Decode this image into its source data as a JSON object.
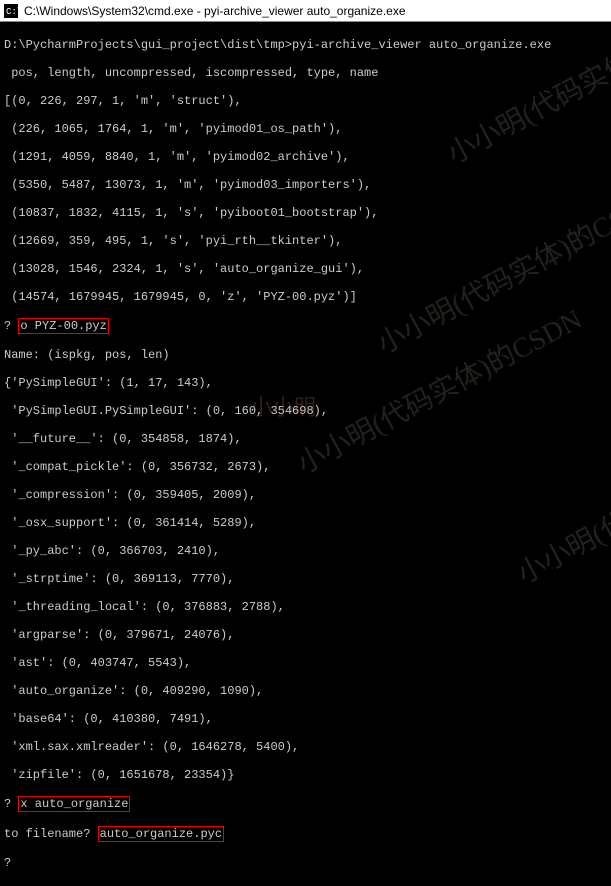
{
  "titlebar": {
    "icon": "cmd-icon",
    "text": "C:\\Windows\\System32\\cmd.exe - pyi-archive_viewer  auto_organize.exe"
  },
  "prompt_line": "D:\\PycharmProjects\\gui_project\\dist\\tmp>pyi-archive_viewer auto_organize.exe",
  "header": " pos, length, uncompressed, iscompressed, type, name",
  "rows": [
    "[(0, 226, 297, 1, 'm', 'struct'),",
    " (226, 1065, 1764, 1, 'm', 'pyimod01_os_path'),",
    " (1291, 4059, 8840, 1, 'm', 'pyimod02_archive'),",
    " (5350, 5487, 13073, 1, 'm', 'pyimod03_importers'),",
    " (10837, 1832, 4115, 1, 's', 'pyiboot01_bootstrap'),",
    " (12669, 359, 495, 1, 's', 'pyi_rth__tkinter'),",
    " (13028, 1546, 2324, 1, 's', 'auto_organize_gui'),",
    " (14574, 1679945, 1679945, 0, 'z', 'PYZ-00.pyz')]"
  ],
  "cmd1_prefix": "? ",
  "cmd1_box": "o PYZ-00.pyz",
  "name_line": "Name: (ispkg, pos, len)",
  "pkg_rows": [
    "{'PySimpleGUI': (1, 17, 143),",
    " 'PySimpleGUI.PySimpleGUI': (0, 160, 354698),",
    " '__future__': (0, 354858, 1874),",
    " '_compat_pickle': (0, 356732, 2673),",
    " '_compression': (0, 359405, 2009),",
    " '_osx_support': (0, 361414, 5289),",
    " '_py_abc': (0, 366703, 2410),",
    " '_strptime': (0, 369113, 7770),",
    " '_threading_local': (0, 376883, 2788),",
    " 'argparse': (0, 379671, 24076),",
    " 'ast': (0, 403747, 5543),",
    " 'auto_organize': (0, 409290, 1090),",
    " 'base64': (0, 410380, 7491),"
  ],
  "pkg_tail": [
    " 'xml.sax.xmlreader': (0, 1646278, 5400),",
    " 'zipfile': (0, 1651678, 23354)}"
  ],
  "cmd2_prefix": "? ",
  "cmd2_box": "x auto_organize",
  "cmd3_prefix": "to filename? ",
  "cmd3_box": "auto_organize.pyc",
  "final_prompt": "?",
  "watermark": "小小明(代码实体)的CSDN",
  "watermark_short": "小小明"
}
